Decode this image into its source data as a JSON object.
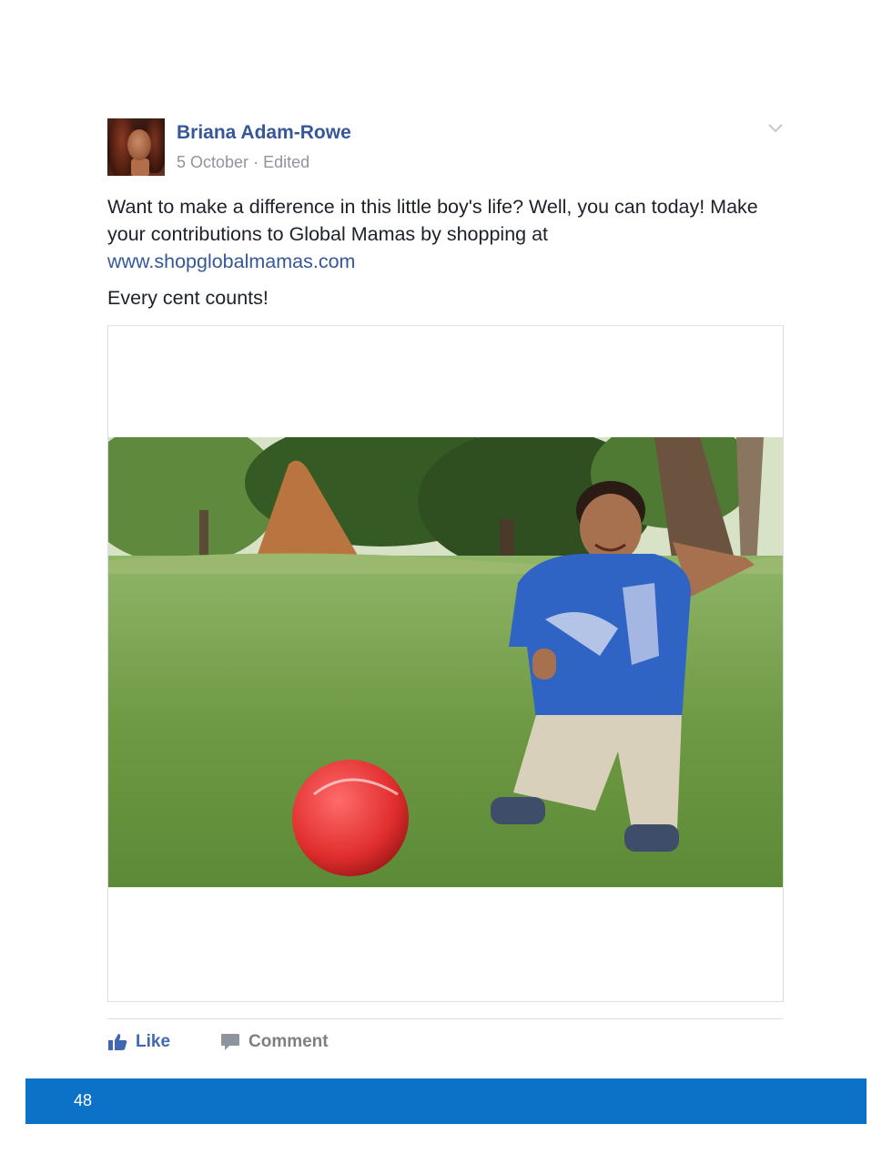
{
  "post": {
    "author": "Briana Adam-Rowe",
    "date": "5 October",
    "separator": "·",
    "edited": "Edited",
    "text_line1": "Want to make a difference in this little boy's life? Well, you can today! Make your contributions to Global Mamas by shopping at",
    "link": "www.shopglobalmamas.com",
    "text_line2": "Every cent counts!"
  },
  "actions": {
    "like_label": "Like",
    "comment_label": "Comment"
  },
  "footer": {
    "page_number": "48"
  },
  "colors": {
    "link_blue": "#365899",
    "like_blue": "#4267b2",
    "footer_blue": "#0b72c8",
    "meta_gray": "#90949c"
  },
  "icons": [
    "chevron-down-icon",
    "thumbs-up-icon",
    "comment-icon"
  ]
}
